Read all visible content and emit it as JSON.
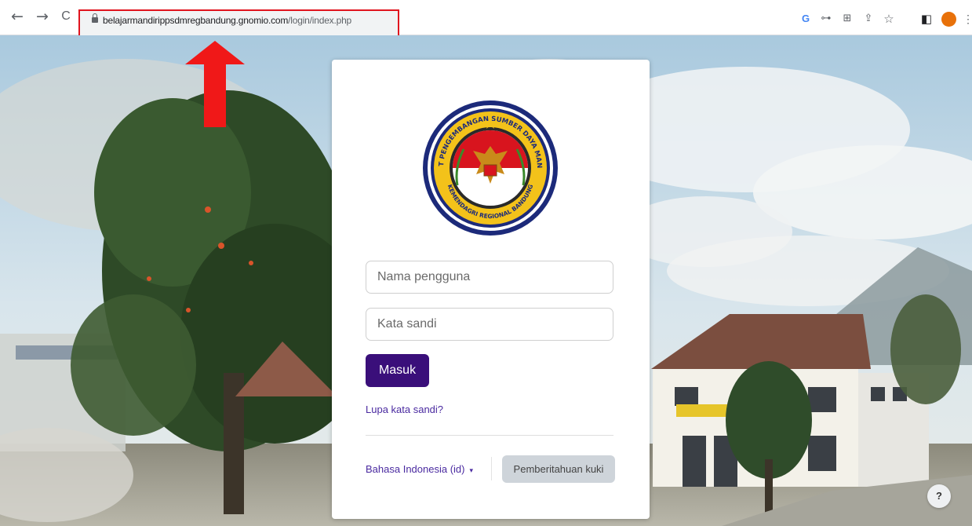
{
  "browser": {
    "nav": {
      "back": "←",
      "forward": "→",
      "reload": "C"
    },
    "address_bar": {
      "domain": "belajarmandirippsdmregbandung.gnomio.com",
      "path": "/login/index.php"
    },
    "toolbar_icons": [
      "google-icon",
      "key-icon",
      "translate-icon",
      "share-icon",
      "star-icon",
      "sidepanel-icon",
      "profile-avatar",
      "menu-dots-icon"
    ],
    "icon_glyphs": {
      "google": "G",
      "key": "⊶",
      "translate": "⊞",
      "share": "⇪",
      "star": "☆",
      "sidepanel": "◧",
      "menu": "⋮"
    },
    "colors": {
      "highlight": "#e0141e",
      "arrow": "#f01818"
    }
  },
  "login": {
    "username_placeholder": "Nama pengguna",
    "password_placeholder": "Kata sandi",
    "submit_label": "Masuk",
    "forgot_label": "Lupa kata sandi?",
    "language_label": "Bahasa Indonesia (id)",
    "language_caret": "▾",
    "cookie_label": "Pemberitahuan kuki",
    "colors": {
      "primary": "#3a0f7a",
      "link": "#4a2aa0"
    }
  },
  "logo": {
    "outer_text": "PUSAT PENGEMBANGAN SUMBER DAYA MANUSIA",
    "inner_text": "KEMENDAGRI REGIONAL BANDUNG"
  },
  "help": {
    "label": "?"
  }
}
